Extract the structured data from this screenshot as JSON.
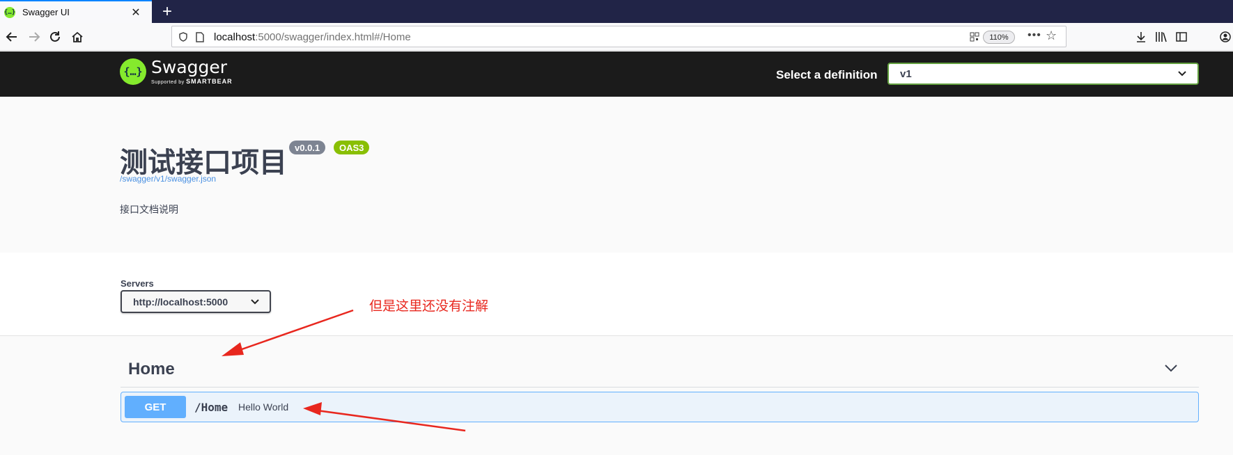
{
  "browser": {
    "tab_title": "Swagger UI",
    "tab_favicon": "{…}",
    "tab_close": "✕",
    "new_tab": "+",
    "url_host": "localhost",
    "url_rest": ":5000/swagger/index.html#/Home",
    "zoom": "110%"
  },
  "topbar": {
    "logo_glyph": "{…}",
    "logo_word": "Swagger",
    "logo_supported": "Supported by ",
    "logo_brand": "SMARTBEAR",
    "definition_label": "Select a definition",
    "definition_value": "v1"
  },
  "info": {
    "title": "测试接口项目",
    "version": "v0.0.1",
    "oas": "OAS3",
    "spec_link": "/swagger/v1/swagger.json",
    "description": "接口文档说明"
  },
  "servers": {
    "label": "Servers",
    "selected": "http://localhost:5000"
  },
  "tags": [
    {
      "name": "Home",
      "operations": [
        {
          "method": "GET",
          "path": "/Home",
          "summary": "Hello World"
        }
      ]
    }
  ],
  "annotation": {
    "text": "但是这里还没有注解",
    "color": "#e8271e"
  },
  "colors": {
    "browser_tabbar": "#212447",
    "swagger_topbar": "#1b1b1b",
    "swagger_green": "#85ea2d",
    "get_blue": "#61affe",
    "oas_badge": "#89bf04",
    "version_badge": "#7d8492"
  }
}
